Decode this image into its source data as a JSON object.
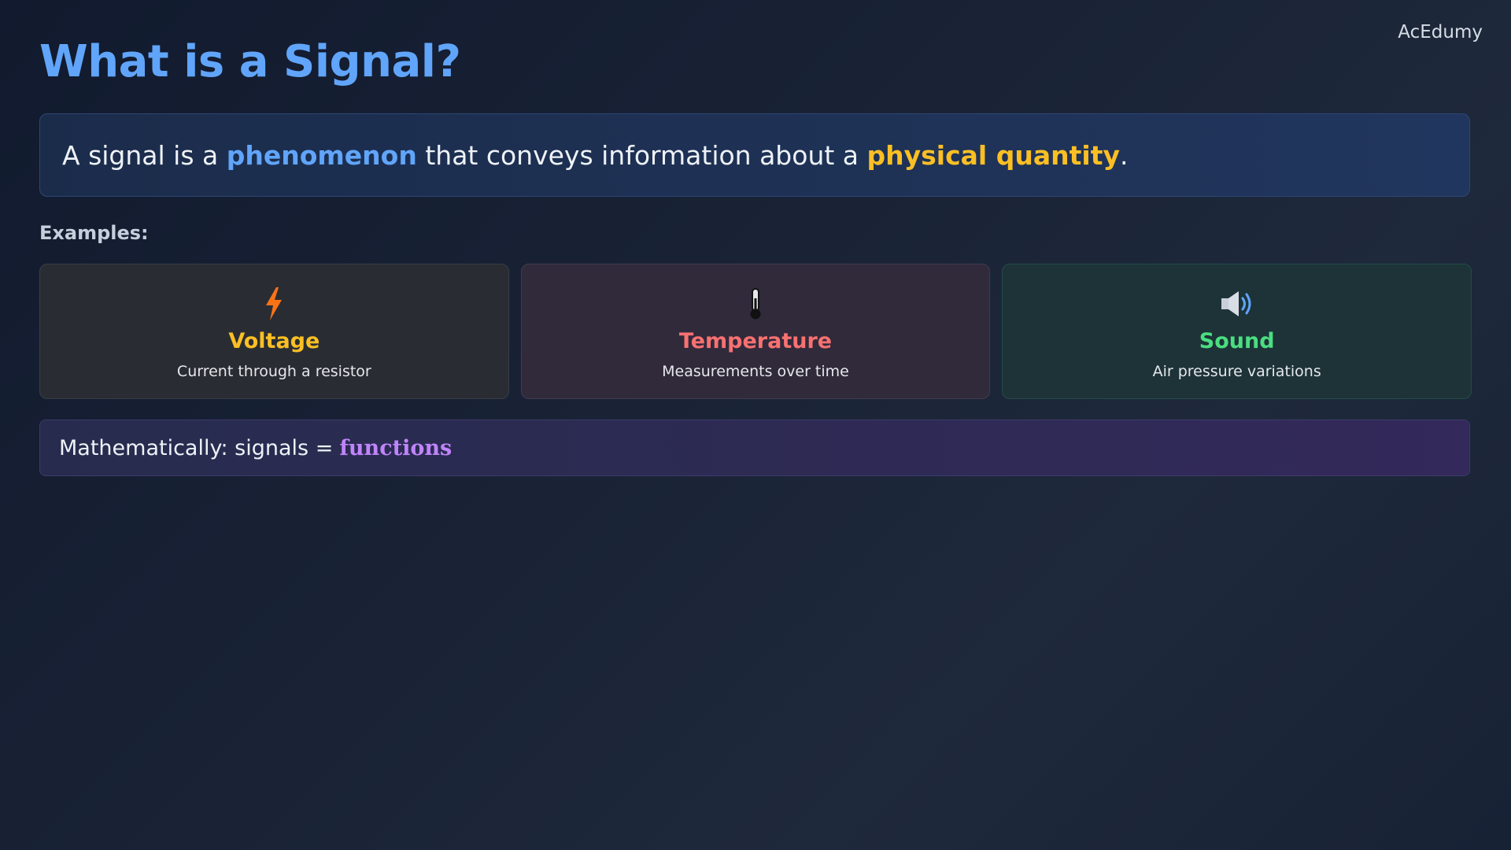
{
  "brand": "AcEdumy",
  "title": "What is a Signal?",
  "definition": {
    "prefix": "A signal is a",
    "term1": "phenomenon",
    "middle": "that conveys information about a",
    "term2": "physical quantity",
    "suffix": "."
  },
  "examples_label": "Examples:",
  "examples": [
    {
      "icon": "lightning-bolt-icon",
      "title": "Voltage",
      "desc": "Current through a resistor",
      "color": "#fbbf24"
    },
    {
      "icon": "thermometer-icon",
      "title": "Temperature",
      "desc": "Measurements over time",
      "color": "#f87171"
    },
    {
      "icon": "speaker-icon",
      "title": "Sound",
      "desc": "Air pressure variations",
      "color": "#4ade80"
    }
  ],
  "math": {
    "prefix": "Mathematically: signals =",
    "term": "functions"
  },
  "colors": {
    "accent_blue": "#60a5fa",
    "accent_gold": "#fbbf24",
    "accent_purple": "#c084fc"
  }
}
